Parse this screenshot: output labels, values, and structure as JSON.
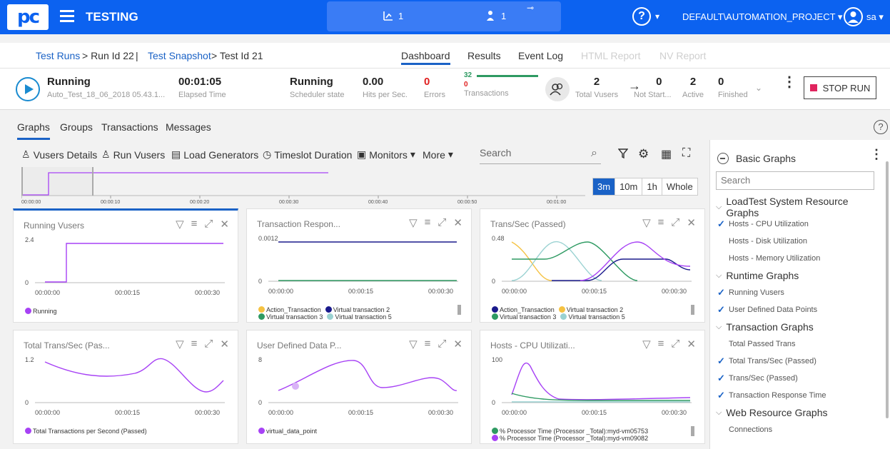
{
  "topbar": {
    "logo": "pc",
    "title": "TESTING",
    "pill": {
      "lg_count": "1",
      "vuser_count": "1"
    },
    "project": "DEFAULT\\AUTOMATION_PROJECT",
    "user": "sa"
  },
  "breadcrumb": {
    "test_runs": "Test Runs",
    "run_id": "> Run Id 22",
    "sep": "|",
    "snapshot": "Test Snapshot",
    "test_id": "> Test Id 21"
  },
  "nav_tabs": [
    "Dashboard",
    "Results",
    "Event Log",
    "HTML Report",
    "NV Report"
  ],
  "status": {
    "run_state": "Running",
    "test_name": "Auto_Test_18_06_2018 05.43.1...",
    "elapsed": "00:01:05",
    "elapsed_label": "Elapsed Time",
    "scheduler": "Running",
    "scheduler_label": "Scheduler state",
    "hits": "0.00",
    "hits_label": "Hits per Sec.",
    "errors": "0",
    "errors_label": "Errors",
    "trans_pass": "32",
    "trans_fail": "0",
    "trans_label": "Transactions",
    "total_vusers": "2",
    "total_vusers_label": "Total Vusers",
    "not_started": "0",
    "not_started_label": "Not Start...",
    "active": "2",
    "active_label": "Active",
    "finished": "0",
    "finished_label": "Finished",
    "stop_label": "STOP RUN"
  },
  "graph_tabs": [
    "Graphs",
    "Groups",
    "Transactions",
    "Messages"
  ],
  "toolbar": {
    "vusers_details": "Vusers Details",
    "run_vusers": "Run Vusers",
    "load_generators": "Load Generators",
    "timeslot": "Timeslot Duration",
    "monitors": "Monitors",
    "more": "More",
    "search_placeholder": "Search"
  },
  "timeline": {
    "ticks": [
      "00:00:00",
      "00:00:10",
      "00:00:20",
      "00:00:30",
      "00:00:40",
      "00:00:50",
      "00:01:00"
    ],
    "ranges": [
      "3m",
      "10m",
      "1h",
      "Whole"
    ]
  },
  "cards": [
    {
      "title": "Running Vusers",
      "ymax": "2.4",
      "ymin": "0",
      "xticks": [
        "00:00:00",
        "00:00:15",
        "00:00:30"
      ],
      "legend": [
        {
          "label": "Running",
          "color": "#a742f5"
        }
      ]
    },
    {
      "title": "Transaction Respon...",
      "ymax": "0.0012",
      "ymin": "0",
      "xticks": [
        "00:00:00",
        "00:00:15",
        "00:00:30"
      ],
      "legend": [
        {
          "label": "Action_Transaction",
          "color": "#f5c242"
        },
        {
          "label": "Virtual transaction 2",
          "color": "#1a1a8c"
        },
        {
          "label": "Virtual transaction 3",
          "color": "#2e9a62"
        },
        {
          "label": "Virtual transaction 5",
          "color": "#9ad2d2"
        }
      ]
    },
    {
      "title": "Trans/Sec (Passed)",
      "ymax": "0.48",
      "ymin": "0",
      "xticks": [
        "00:00:00",
        "00:00:15",
        "00:00:30"
      ],
      "legend": [
        {
          "label": "Action_Transaction",
          "color": "#1a1a8c"
        },
        {
          "label": "Virtual transaction 2",
          "color": "#f5c242"
        },
        {
          "label": "Virtual transaction 3",
          "color": "#2e9a62"
        },
        {
          "label": "Virtual transaction 5",
          "color": "#9ad2d2"
        }
      ]
    },
    {
      "title": "Total Trans/Sec (Pas...",
      "ymax": "1.2",
      "ymin": "0",
      "xticks": [
        "00:00:00",
        "00:00:15",
        "00:00:30"
      ],
      "legend": [
        {
          "label": "Total Transactions per Second (Passed)",
          "color": "#a742f5"
        }
      ]
    },
    {
      "title": "User Defined Data P...",
      "ymax": "8",
      "ymin": "0",
      "xticks": [
        "00:00:00",
        "00:00:15",
        "00:00:30"
      ],
      "legend": [
        {
          "label": "virtual_data_point",
          "color": "#a742f5"
        }
      ]
    },
    {
      "title": "Hosts - CPU Utilizati...",
      "ymax": "100",
      "ymin": "0",
      "xticks": [
        "00:00:00",
        "00:00:15",
        "00:00:30"
      ],
      "legend": [
        {
          "label": "% Processor Time (Processor _Total):myd-vm05753",
          "color": "#2e9a62"
        },
        {
          "label": "% Processor Time (Processor _Total):myd-vm09082",
          "color": "#a742f5"
        }
      ]
    }
  ],
  "sidepanel": {
    "title": "Basic Graphs",
    "search_placeholder": "Search",
    "groups": [
      {
        "label": "LoadTest System Resource Graphs",
        "items": [
          {
            "label": "Hosts - CPU Utilization",
            "checked": true
          },
          {
            "label": "Hosts - Disk Utilization",
            "checked": false
          },
          {
            "label": "Hosts - Memory Utilization",
            "checked": false
          }
        ]
      },
      {
        "label": "Runtime Graphs",
        "items": [
          {
            "label": "Running Vusers",
            "checked": true
          },
          {
            "label": "User Defined Data Points",
            "checked": true
          }
        ]
      },
      {
        "label": "Transaction Graphs",
        "items": [
          {
            "label": "Total Passed Trans",
            "checked": false
          },
          {
            "label": "Total Trans/Sec (Passed)",
            "checked": true
          },
          {
            "label": "Trans/Sec (Passed)",
            "checked": true
          },
          {
            "label": "Transaction Response Time",
            "checked": true
          }
        ]
      },
      {
        "label": "Web Resource Graphs",
        "items": [
          {
            "label": "Connections",
            "checked": false
          }
        ]
      }
    ]
  },
  "colors": {
    "brand": "#0c62f0",
    "accent": "#1a62c6",
    "purple": "#a742f5"
  }
}
